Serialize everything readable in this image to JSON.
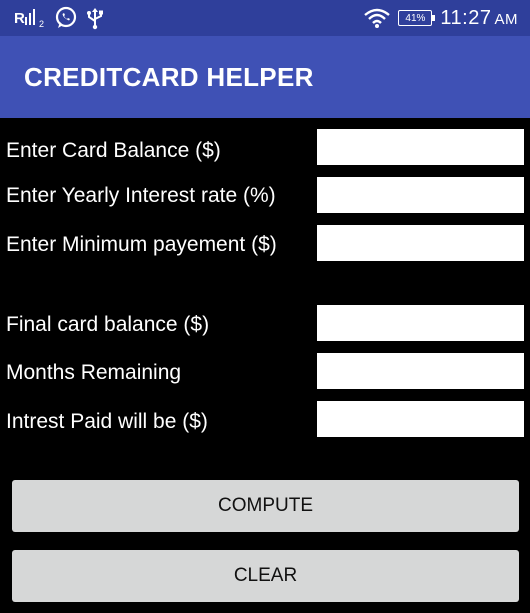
{
  "status_bar": {
    "time": "11:27",
    "ampm": "AM",
    "battery": "41%",
    "icons": [
      "signal-icon",
      "whatsapp-icon",
      "usb-icon",
      "wifi-icon",
      "battery-icon"
    ]
  },
  "toolbar": {
    "title": "CREDITCARD HELPER"
  },
  "form": {
    "balance_label": "Enter Card Balance ($)",
    "balance_value": "",
    "rate_label": "Enter Yearly Interest rate (%)",
    "rate_value": "",
    "payment_label": "Enter Minimum payement ($)",
    "payment_value": ""
  },
  "results": {
    "final_label": "Final card balance ($)",
    "final_value": "",
    "months_label": "Months Remaining",
    "months_value": "",
    "interest_label": "Intrest Paid will be ($)",
    "interest_value": ""
  },
  "buttons": {
    "compute": "COMPUTE",
    "clear": "CLEAR"
  },
  "colors": {
    "toolbar": "#3f51b5",
    "status_bar": "#2f3f9b",
    "background": "#000000",
    "button": "#d6d7d7"
  }
}
